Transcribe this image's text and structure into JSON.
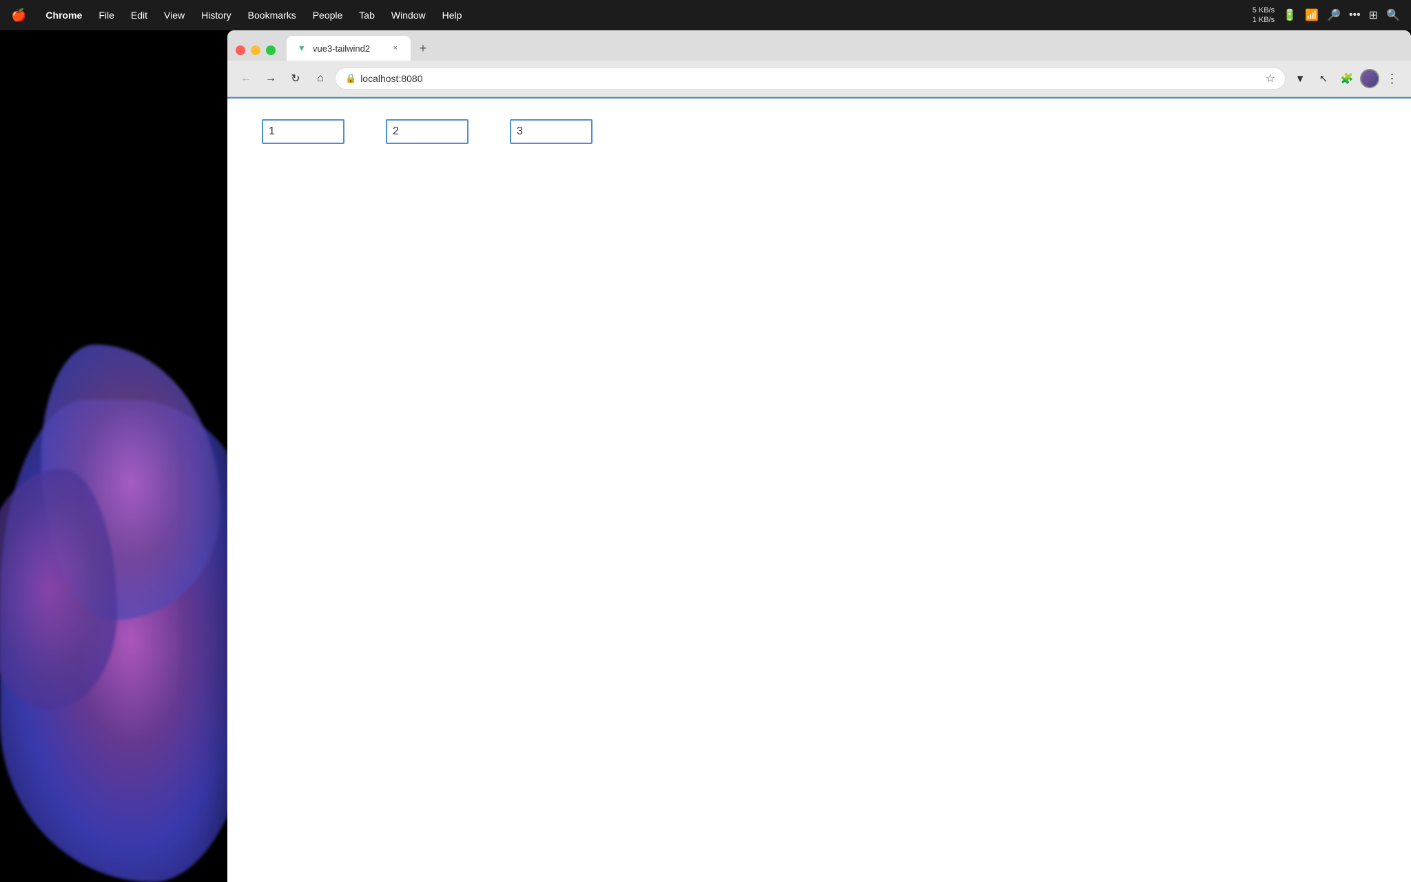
{
  "menubar": {
    "apple_symbol": "🍎",
    "items": [
      {
        "id": "chrome",
        "label": "Chrome",
        "bold": true
      },
      {
        "id": "file",
        "label": "File"
      },
      {
        "id": "edit",
        "label": "Edit"
      },
      {
        "id": "view",
        "label": "View"
      },
      {
        "id": "history",
        "label": "History"
      },
      {
        "id": "bookmarks",
        "label": "Bookmarks"
      },
      {
        "id": "people",
        "label": "People"
      },
      {
        "id": "tab",
        "label": "Tab"
      },
      {
        "id": "window",
        "label": "Window"
      },
      {
        "id": "help",
        "label": "Help"
      }
    ],
    "network_up": "5 KB/s",
    "network_down": "1 KB/s"
  },
  "browser": {
    "tab_title": "vue3-tailwind2",
    "tab_favicon": "▼",
    "url": "localhost:8080",
    "add_tab_label": "+",
    "close_tab_label": "×",
    "menu_dots": "⋮"
  },
  "page": {
    "inputs": [
      {
        "id": "input-1",
        "value": "1"
      },
      {
        "id": "input-2",
        "value": "2"
      },
      {
        "id": "input-3",
        "value": "3"
      }
    ]
  }
}
